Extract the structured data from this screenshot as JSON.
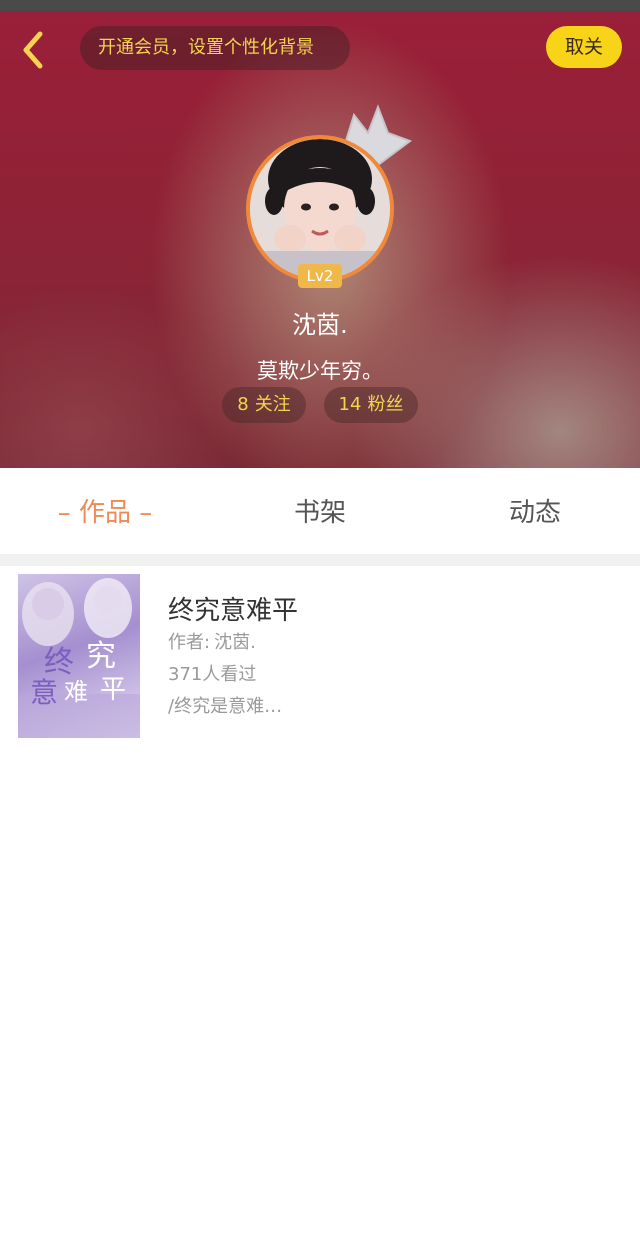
{
  "header": {
    "vip_banner": "开通会员，设置个性化背景",
    "unfollow_label": "取关"
  },
  "profile": {
    "level": "Lv2",
    "username": "沈茵.",
    "signature": "莫欺少年穷。",
    "following_count": "8",
    "following_label": "关注",
    "fans_count": "14",
    "fans_label": "粉丝"
  },
  "tabs": [
    {
      "label": "– 作品 –",
      "active": true
    },
    {
      "label": "书架",
      "active": false
    },
    {
      "label": "动态",
      "active": false
    }
  ],
  "works": [
    {
      "title": "终究意难平",
      "author_label": "作者:",
      "author": "沈茵.",
      "reads": "371人看过",
      "desc": "/终究是意难…",
      "cover_text": [
        "终",
        "究",
        "意",
        "难",
        "平"
      ]
    }
  ],
  "colors": {
    "accent_yellow": "#f7d417",
    "tab_active": "#ef8a56",
    "avatar_ring": "#f08a3a",
    "level_badge": "#f0b74a"
  }
}
